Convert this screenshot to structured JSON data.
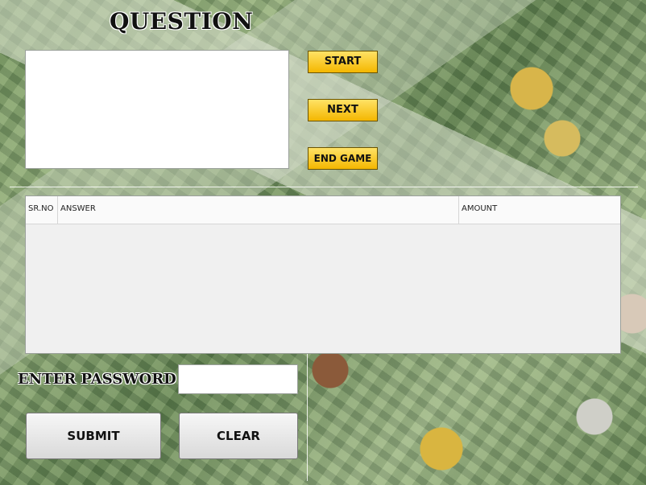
{
  "title": "QUESTION",
  "buttons": {
    "start": "START",
    "next": "NEXT",
    "end_game": "END GAME",
    "submit": "SUBMIT",
    "clear": "CLEAR"
  },
  "grid": {
    "columns": [
      "SR.NO",
      "ANSWER",
      "AMOUNT"
    ],
    "rows": []
  },
  "password": {
    "label": "ENTER PASSWORD",
    "value": ""
  },
  "colors": {
    "accent_button": "#f4b700",
    "background_theme": "#7a9a66"
  }
}
